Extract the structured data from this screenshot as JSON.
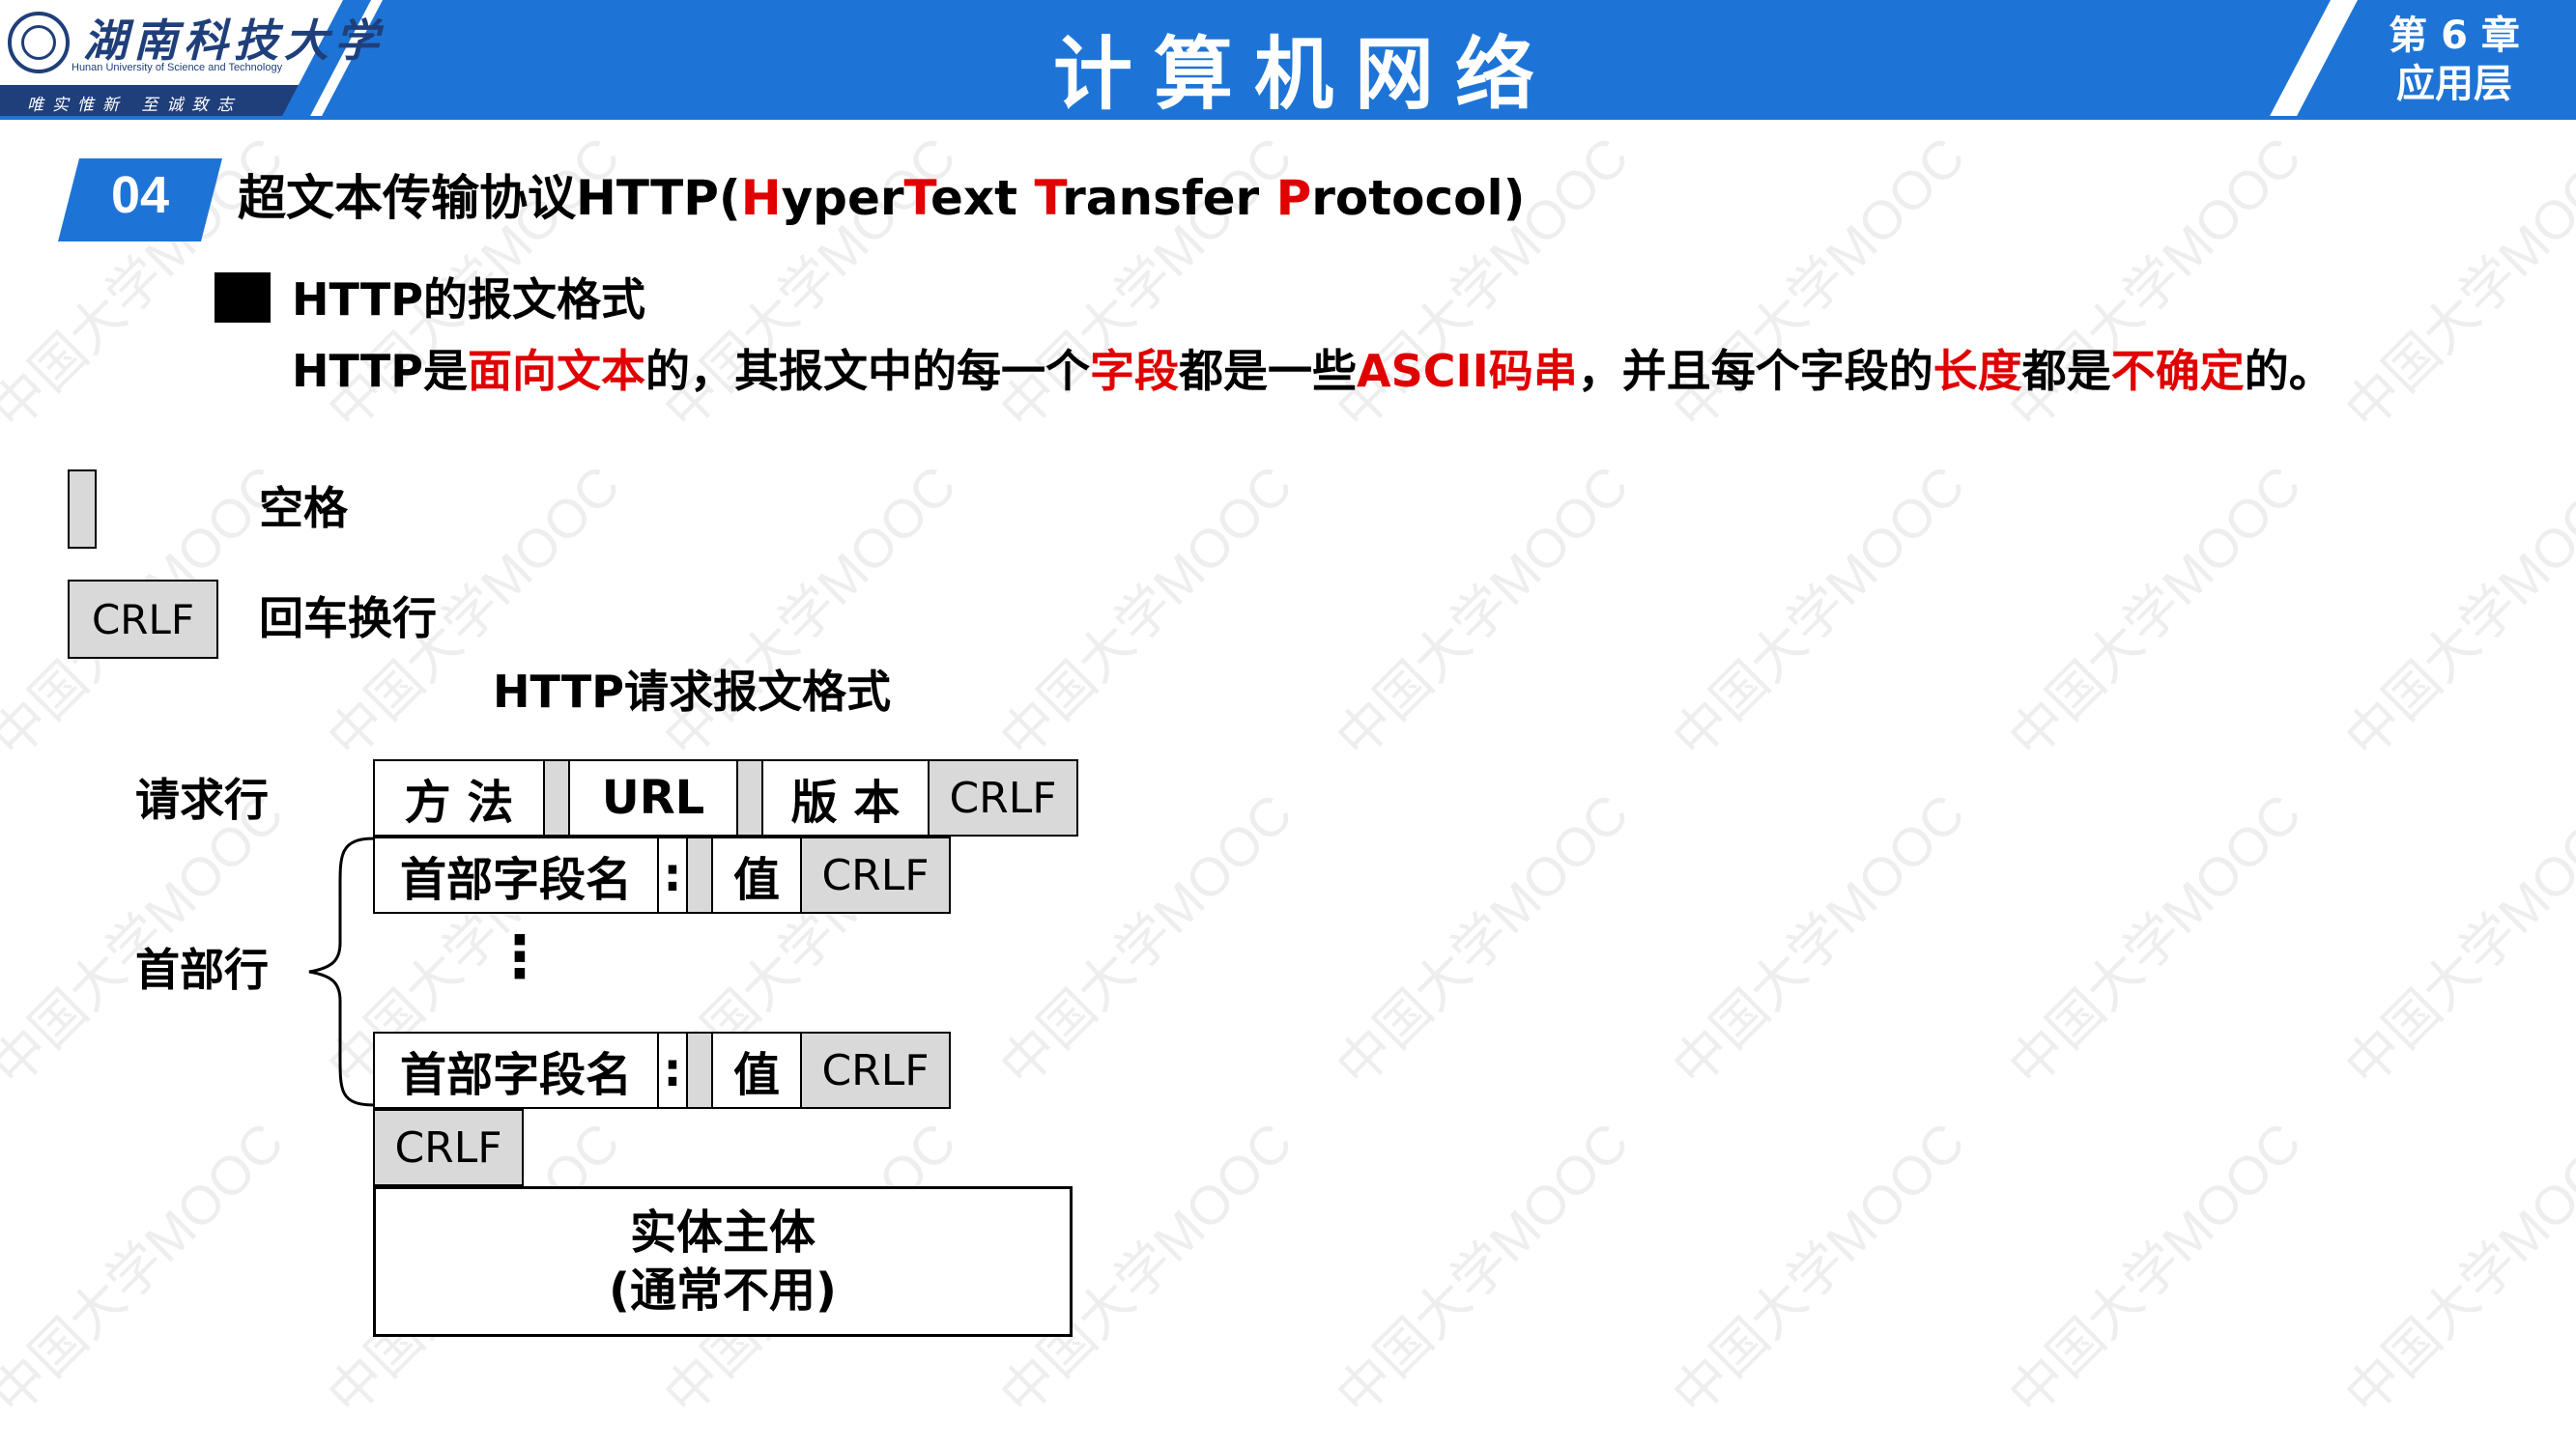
{
  "header": {
    "school_name": "湖南科技大学",
    "school_name_en": "Hunan University of Science and Technology",
    "motto": "唯实惟新  至诚致志",
    "course_title": "计算机网络",
    "chapter_line1": "第 6 章",
    "chapter_line2": "应用层",
    "colors": {
      "band": "#1e74d6",
      "dark": "#1f3f7a"
    }
  },
  "watermark": {
    "text": "中国大学MOOC"
  },
  "section": {
    "number": "04",
    "title_prefix": "超文本传输协议HTTP(",
    "title_h": "H",
    "title_yper": "yper",
    "title_t": "T",
    "title_ext": "ext ",
    "title_t2": "T",
    "title_ransfer": "ransfer ",
    "title_p": "P",
    "title_rotocol": "rotocol)",
    "badge_color": "#1e74d6",
    "highlight_color": "#e00000"
  },
  "subheading": "HTTP的报文格式",
  "description": {
    "p1": "HTTP是",
    "r1": "面向文本",
    "p2": "的，其报文中的每一个",
    "r2": "字段",
    "p3": "都是一些",
    "r3": "ASCII码串",
    "p4": "，并且每个字段的",
    "r4": "长度",
    "p5": "都是",
    "r5": "不确定",
    "p6": "的。"
  },
  "legend": {
    "space_label": "空格",
    "crlf_box": "CRLF",
    "crlf_label": "回车换行"
  },
  "diagram": {
    "title": "HTTP请求报文格式",
    "request_line_label": "请求行",
    "header_lines_label": "首部行",
    "request_line": {
      "method": "方 法",
      "url": "URL",
      "version": "版 本",
      "crlf": "CRLF"
    },
    "header_line": {
      "field_name": "首部字段名",
      "colon": ":",
      "value": "值",
      "crlf": "CRLF"
    },
    "ellipsis": "⋮",
    "blank_line_crlf": "CRLF",
    "body_line1": "实体主体",
    "body_line2": "(通常不用)"
  }
}
